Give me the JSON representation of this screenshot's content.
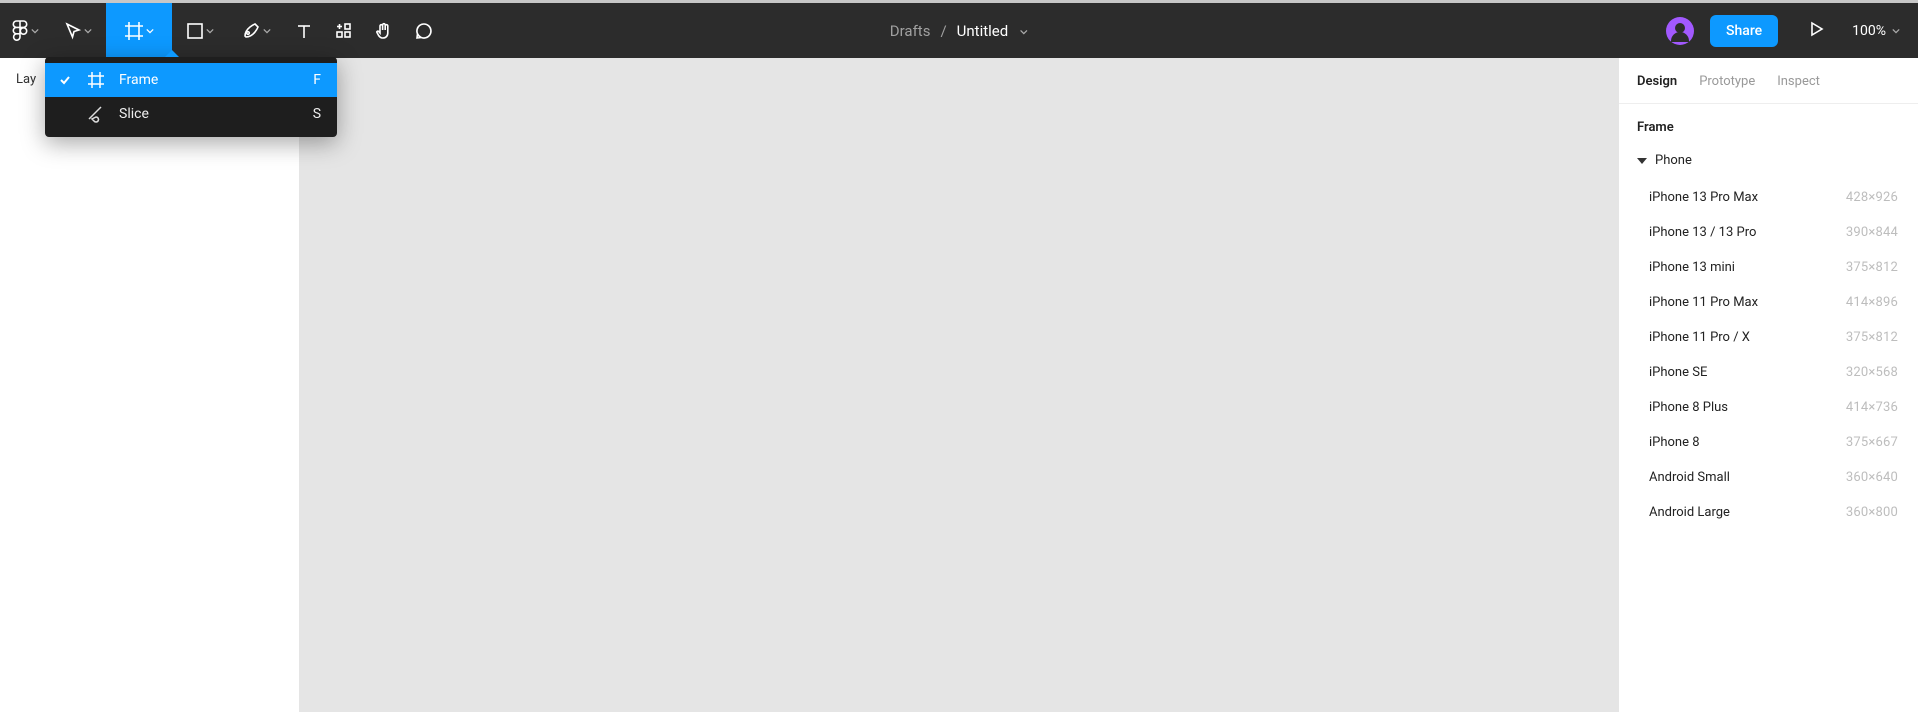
{
  "toolbar": {
    "doc_location": "Drafts",
    "doc_name": "Untitled",
    "share_label": "Share",
    "zoom_label": "100%"
  },
  "left_panel": {
    "tab_label": "Lay"
  },
  "dropdown": {
    "items": [
      {
        "label": "Frame",
        "shortcut": "F",
        "selected": true
      },
      {
        "label": "Slice",
        "shortcut": "S",
        "selected": false
      }
    ]
  },
  "right_panel": {
    "tabs": [
      {
        "label": "Design",
        "active": true
      },
      {
        "label": "Prototype",
        "active": false
      },
      {
        "label": "Inspect",
        "active": false
      }
    ],
    "section_title": "Frame",
    "group_header": "Phone",
    "presets": [
      {
        "name": "iPhone 13 Pro Max",
        "dim": "428×926"
      },
      {
        "name": "iPhone 13 / 13 Pro",
        "dim": "390×844"
      },
      {
        "name": "iPhone 13 mini",
        "dim": "375×812"
      },
      {
        "name": "iPhone 11 Pro Max",
        "dim": "414×896"
      },
      {
        "name": "iPhone 11 Pro / X",
        "dim": "375×812"
      },
      {
        "name": "iPhone SE",
        "dim": "320×568"
      },
      {
        "name": "iPhone 8 Plus",
        "dim": "414×736"
      },
      {
        "name": "iPhone 8",
        "dim": "375×667"
      },
      {
        "name": "Android Small",
        "dim": "360×640"
      },
      {
        "name": "Android Large",
        "dim": "360×800"
      }
    ]
  }
}
